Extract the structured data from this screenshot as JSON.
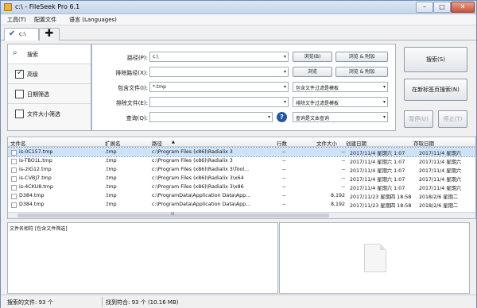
{
  "window": {
    "title": "c:\\ - FileSeek Pro 6.1",
    "min": "–",
    "max": "□",
    "close": "✕"
  },
  "menu": [
    "工具(T)",
    "配置文件",
    "语言 (Languages)"
  ],
  "tab": {
    "label": "c:\\",
    "add": "✚"
  },
  "nav": {
    "search": "搜索",
    "advanced": "高级",
    "date": "日期筛选",
    "size": "文件大小筛选"
  },
  "form": {
    "path_label": "路径(P):",
    "path_value": "c:\\",
    "exclude_path_label": "排除路径(X):",
    "exclude_path_value": "",
    "include_files_label": "包含文件(I):",
    "include_files_value": "*.tmp",
    "exclude_files_label": "排除文件(E):",
    "exclude_files_value": "",
    "query_label": "查询(Q):",
    "query_value": "",
    "browse1": "浏览(B)",
    "browse_add1": "浏览 & 附加",
    "browse2": "浏览",
    "browse_add2": "浏览 & 附加",
    "include_template": "包含文件过滤是模板",
    "exclude_template": "排除文件过滤是模板",
    "query_text": "查询是文本查询",
    "help": "?"
  },
  "actions": {
    "search": "搜索(S)",
    "new_tab_search": "在新标签页搜索(N)",
    "pause": "暂停(U)",
    "stop": "停止(T)"
  },
  "columns": [
    "文件名",
    "扩展名",
    "路径",
    "行数",
    "文件大小",
    "创建日期",
    "存取日期"
  ],
  "rows": [
    {
      "name": "is-0C157.tmp",
      "ext": ".tmp",
      "path": "c:\\Program Files (x86)\\Radialix 3",
      "lines": "--",
      "size": "--",
      "created": "2017/11/4 星期六 1:07",
      "accessed": "2017/11/4 星期六"
    },
    {
      "name": "is-TBO1L.tmp",
      "ext": ".tmp",
      "path": "c:\\Program Files (x86)\\Radialix 3",
      "lines": "--",
      "size": "--",
      "created": "2017/11/4 星期六 1:07",
      "accessed": "2017/11/4 星期六"
    },
    {
      "name": "is-2IG12.tmp",
      "ext": ".tmp",
      "path": "c:\\Program Files (x86)\\Radialix 3\\Tool...",
      "lines": "--",
      "size": "--",
      "created": "2017/11/4 星期六 1:07",
      "accessed": "2017/11/4 星期六"
    },
    {
      "name": "is-CVBJ7.tmp",
      "ext": ".tmp",
      "path": "c:\\Program Files (x86)\\Radialix 3\\x64",
      "lines": "--",
      "size": "--",
      "created": "2017/11/4 星期六 1:07",
      "accessed": "2017/11/4 星期六"
    },
    {
      "name": "is-4CKU8.tmp",
      "ext": ".tmp",
      "path": "c:\\Program Files (x86)\\Radialix 3\\x86",
      "lines": "--",
      "size": "--",
      "created": "2017/11/4 星期六 1:07",
      "accessed": "2017/11/4 星期六"
    },
    {
      "name": "D384.tmp",
      "ext": ".tmp",
      "path": "c:\\ProgramData\\Application Data\\App...",
      "lines": "--",
      "size": "8,192",
      "created": "2017/11/23 星期四 18:58",
      "accessed": "2018/2/6 星期二"
    },
    {
      "name": "D384.tmp",
      "ext": ".tmp",
      "path": "c:\\ProgramData\\Application Data\\App...",
      "lines": "--",
      "size": "8,192",
      "created": "2017/11/23 星期四 18:58",
      "accessed": "2018/2/6 星期二"
    }
  ],
  "hscroll_mark": "III",
  "bottom": {
    "header": "文件名相符 [包含文件筛选]"
  },
  "status": {
    "found": "搜索的文件: 93 个",
    "matched": "找到符合: 93 个 (10.16 MB)"
  }
}
